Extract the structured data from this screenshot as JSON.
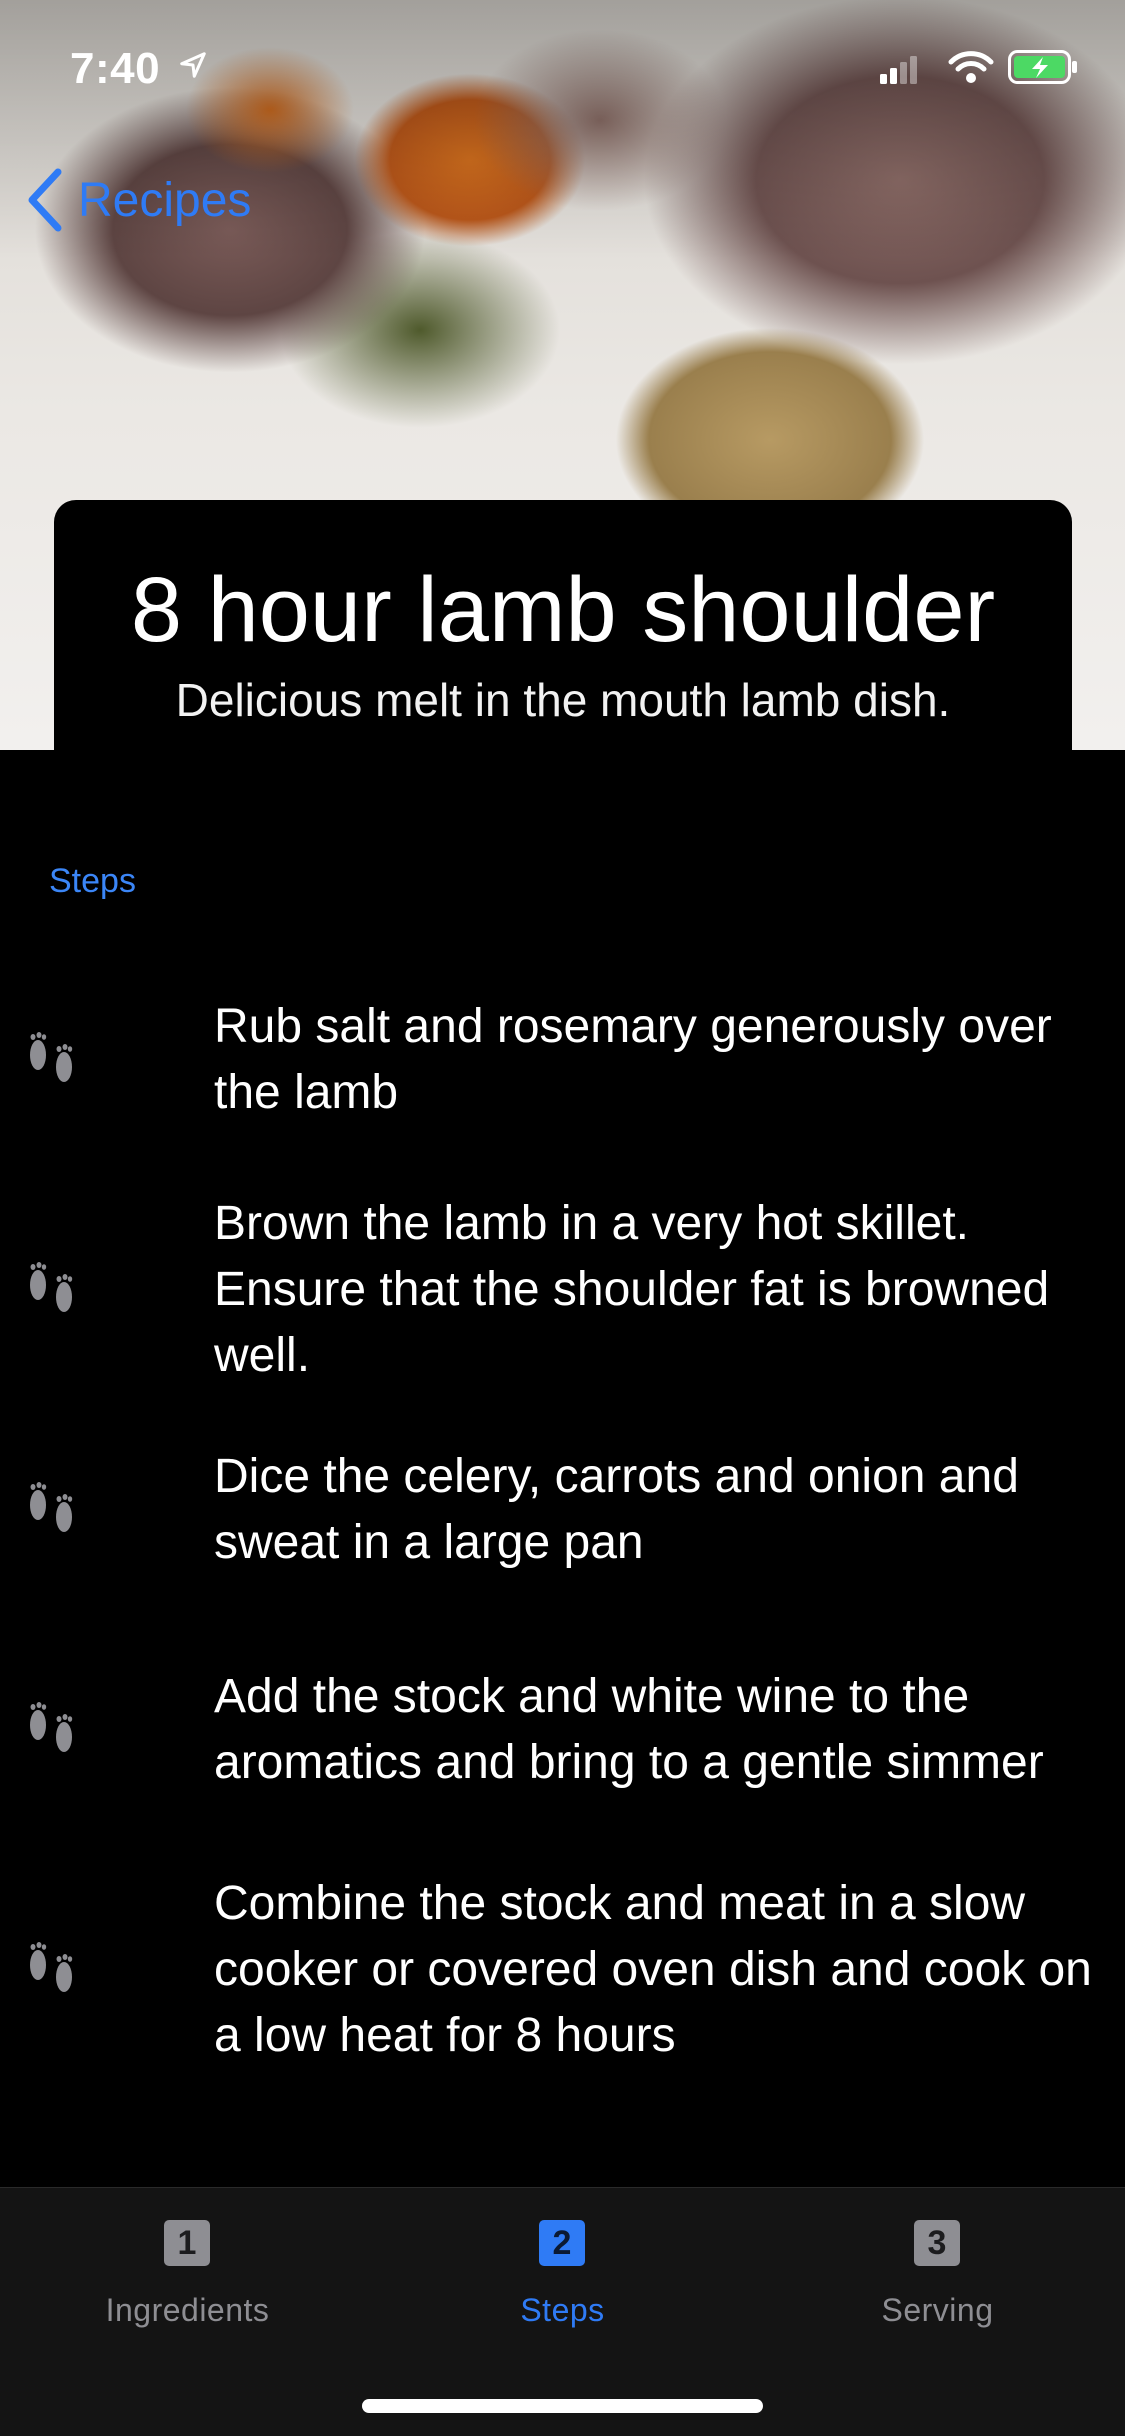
{
  "status_bar": {
    "time": "7:40"
  },
  "nav": {
    "back_label": "Recipes"
  },
  "recipe": {
    "title": "8 hour lamb shoulder",
    "subtitle": "Delicious melt in the mouth lamb dish."
  },
  "steps_section": {
    "header": "Steps",
    "steps": [
      {
        "text": "Rub salt and rosemary generously over the lamb",
        "icon": "footprints-icon"
      },
      {
        "text": "Brown the lamb in a very hot skillet. Ensure that the shoulder fat is browned well.",
        "icon": "footprints-icon"
      },
      {
        "text": "Dice the celery, carrots and onion and sweat in a large pan",
        "icon": "footprints-icon"
      },
      {
        "text": "Add the stock and white wine to the aromatics and bring to a gentle simmer",
        "icon": "footprints-icon"
      },
      {
        "text": "Combine the stock and meat in a slow cooker or covered oven dish and cook on a low heat for 8 hours",
        "icon": "footprints-icon"
      }
    ]
  },
  "tab_bar": {
    "selected": "Steps",
    "tabs": [
      {
        "badge": "1",
        "label": "Ingredients"
      },
      {
        "badge": "2",
        "label": "Steps"
      },
      {
        "badge": "3",
        "label": "Serving"
      }
    ]
  },
  "colors": {
    "accent": "#2f7bf5",
    "background": "#000000",
    "tab_inactive": "#8e8e93"
  }
}
